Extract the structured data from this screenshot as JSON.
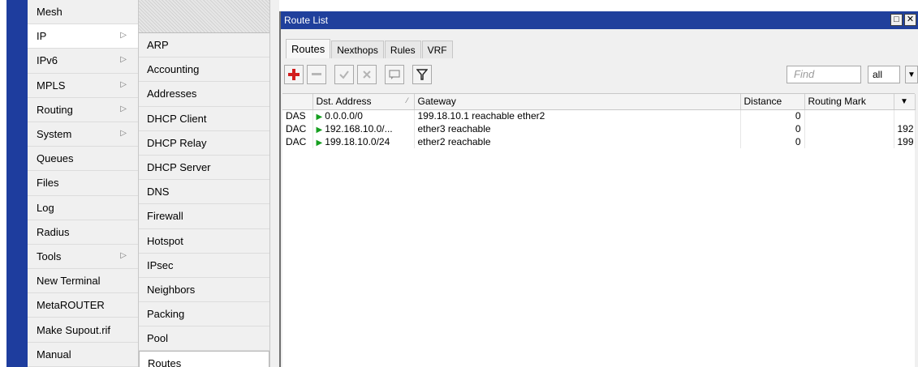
{
  "main_menu": [
    {
      "label": "Mesh",
      "has_submenu": false
    },
    {
      "label": "IP",
      "has_submenu": true,
      "active": true
    },
    {
      "label": "IPv6",
      "has_submenu": true
    },
    {
      "label": "MPLS",
      "has_submenu": true
    },
    {
      "label": "Routing",
      "has_submenu": true
    },
    {
      "label": "System",
      "has_submenu": true
    },
    {
      "label": "Queues",
      "has_submenu": false
    },
    {
      "label": "Files",
      "has_submenu": false
    },
    {
      "label": "Log",
      "has_submenu": false
    },
    {
      "label": "Radius",
      "has_submenu": false
    },
    {
      "label": "Tools",
      "has_submenu": true
    },
    {
      "label": "New Terminal",
      "has_submenu": false
    },
    {
      "label": "MetaROUTER",
      "has_submenu": false
    },
    {
      "label": "Make Supout.rif",
      "has_submenu": false
    },
    {
      "label": "Manual",
      "has_submenu": false
    }
  ],
  "submenu": [
    {
      "label": "ARP"
    },
    {
      "label": "Accounting"
    },
    {
      "label": "Addresses"
    },
    {
      "label": "DHCP Client"
    },
    {
      "label": "DHCP Relay"
    },
    {
      "label": "DHCP Server"
    },
    {
      "label": "DNS"
    },
    {
      "label": "Firewall"
    },
    {
      "label": "Hotspot"
    },
    {
      "label": "IPsec"
    },
    {
      "label": "Neighbors"
    },
    {
      "label": "Packing"
    },
    {
      "label": "Pool"
    },
    {
      "label": "Routes",
      "active": true
    }
  ],
  "window": {
    "title": "Route List",
    "minimize_glyph": "□",
    "close_glyph": "✕"
  },
  "tabs": [
    {
      "label": "Routes",
      "active": true
    },
    {
      "label": "Nexthops"
    },
    {
      "label": "Rules"
    },
    {
      "label": "VRF"
    }
  ],
  "toolbar": {
    "find_placeholder": "Find",
    "filter_value": "all",
    "icons": [
      "add-icon",
      "remove-icon",
      "enable-icon",
      "disable-icon",
      "comment-icon",
      "filter-icon"
    ]
  },
  "table": {
    "columns": [
      "",
      "Dst. Address",
      "Gateway",
      "Distance",
      "Routing Mark",
      ""
    ],
    "rows": [
      {
        "flags": "DAS",
        "dst": "0.0.0.0/0",
        "gateway": "199.18.10.1 reachable ether2",
        "distance": "0",
        "mark": "",
        "extra": ""
      },
      {
        "flags": "DAC",
        "dst": "192.168.10.0/...",
        "gateway": "ether3 reachable",
        "distance": "0",
        "mark": "",
        "extra": "192"
      },
      {
        "flags": "DAC",
        "dst": "199.18.10.0/24",
        "gateway": "ether2 reachable",
        "distance": "0",
        "mark": "",
        "extra": "199"
      }
    ]
  },
  "colors": {
    "titlebar": "#20409c",
    "left_strip": "#1e3d9e",
    "add_icon": "#d21d1d",
    "route_flag": "#159e1f"
  }
}
